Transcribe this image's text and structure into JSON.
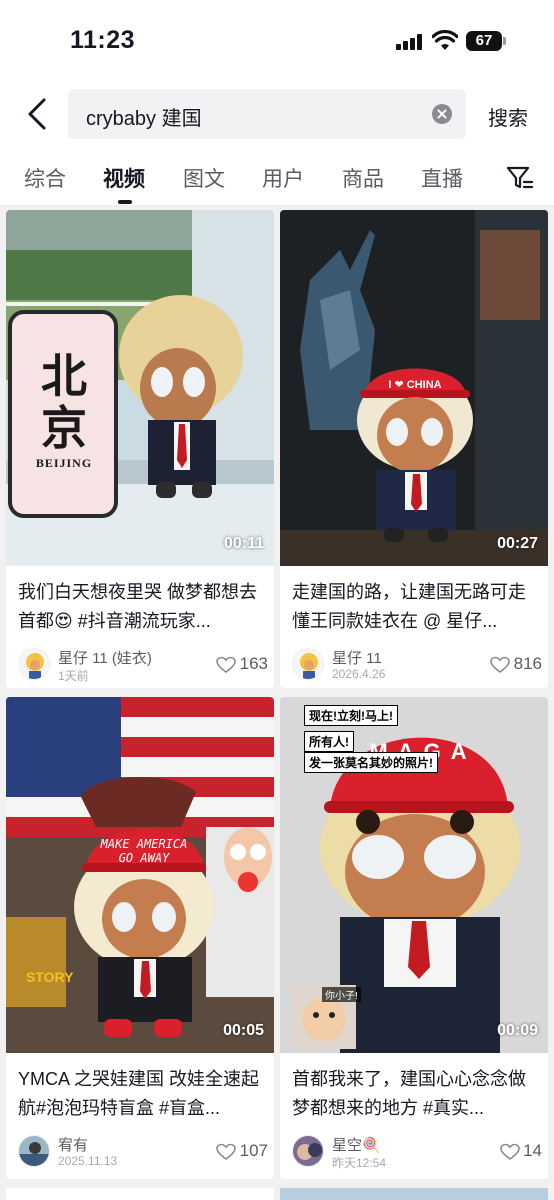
{
  "status": {
    "time": "11:23",
    "battery": "67"
  },
  "search": {
    "query": "crybaby 建国",
    "submit_label": "搜索"
  },
  "tabs": [
    "综合",
    "视频",
    "图文",
    "用户",
    "商品",
    "直播"
  ],
  "cards": [
    {
      "duration": "00:11",
      "title": "我们白天想夜里哭 做梦都想去首都😍 #抖音潮流玩家...",
      "author": "星仔 11 (娃衣)",
      "date": "1天前",
      "likes": "163",
      "sign_top": "北",
      "sign_mid": "京",
      "sign_bottom": "BEIJING"
    },
    {
      "duration": "00:27",
      "title": "走建国的路，让建国无路可走 懂王同款娃衣在 @ 星仔...",
      "author": "星仔 11",
      "date": "2026.4.26",
      "likes": "816",
      "hat_text": "I ❤ CHINA"
    },
    {
      "duration": "00:05",
      "title": "YMCA 之哭娃建国 改娃全速起航#泡泡玛特盲盒 #盲盒...",
      "author": "宥有",
      "date": "2025.11.13",
      "likes": "107",
      "hat_text": "MAKE AMERICA GO AWAY",
      "box_text": "STORY"
    },
    {
      "duration": "00:09",
      "title": "首都我来了，建国心心念念做梦都想来的地方 #真实...",
      "author": "星空🍭",
      "date": "昨天12:54",
      "likes": "14",
      "caption1": "现在!立刻!马上!",
      "caption2": "所有人!",
      "caption3": "发一张莫名其妙的照片!",
      "hat_text": "MAGA",
      "kid_caption": "你小子!"
    }
  ]
}
